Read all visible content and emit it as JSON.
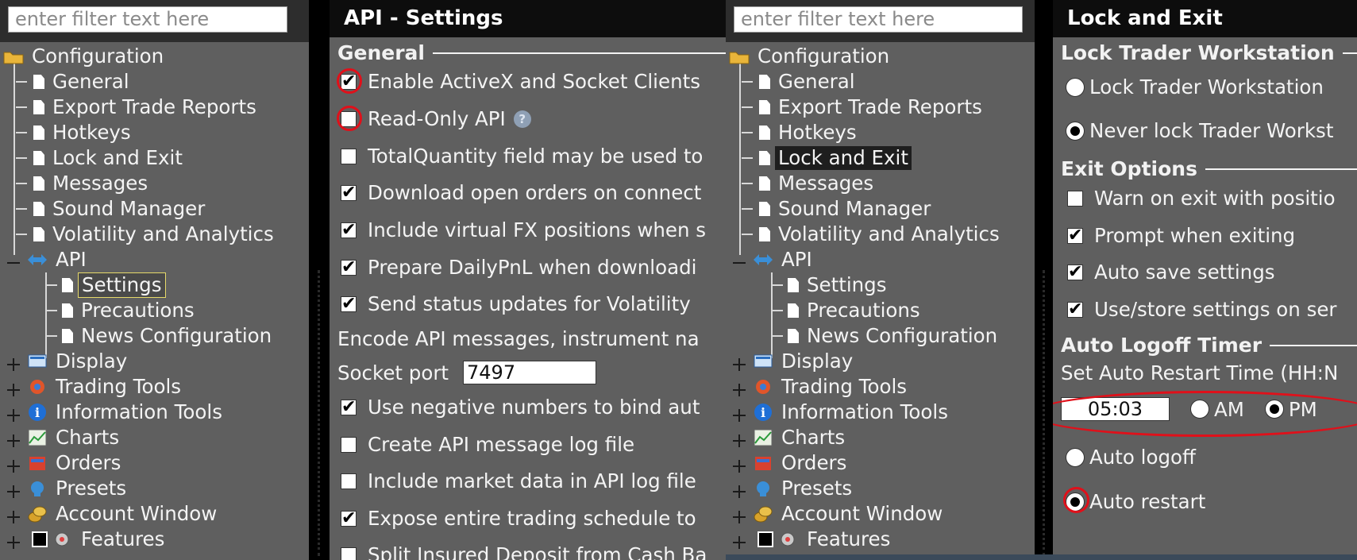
{
  "filter_placeholder": "enter filter text here",
  "tree": {
    "root": "Configuration",
    "items": {
      "general": "General",
      "export": "Export Trade Reports",
      "hotkeys": "Hotkeys",
      "lock": "Lock and Exit",
      "messages": "Messages",
      "sound": "Sound Manager",
      "volatility": "Volatility and Analytics",
      "api": "API",
      "settings": "Settings",
      "precautions": "Precautions",
      "news": "News Configuration",
      "display": "Display",
      "trading_tools": "Trading Tools",
      "info_tools": "Information Tools",
      "charts": "Charts",
      "orders": "Orders",
      "presets": "Presets",
      "account": "Account Window",
      "features": "Features"
    }
  },
  "api_panel": {
    "title": "API - Settings",
    "section_general": "General",
    "enable_activex": "Enable ActiveX and Socket Clients",
    "read_only": "Read-Only API",
    "help_glyph": "?",
    "total_quantity": "TotalQuantity field may be used to",
    "download_orders": "Download open orders on connect",
    "include_fx": "Include virtual FX positions when s",
    "prepare_pnl": "Prepare DailyPnL when downloadi",
    "send_status": "Send status updates for Volatility",
    "encode_api": "Encode API messages, instrument na",
    "socket_label": "Socket port",
    "socket_value": "7497",
    "negative_numbers": "Use negative numbers to bind aut",
    "create_log": "Create API message log file",
    "include_market": "Include market data in API log file",
    "expose_schedule": "Expose entire trading schedule to",
    "split_insured": "Split Insured Deposit from Cash Ba"
  },
  "lock_panel": {
    "title": "Lock and Exit",
    "section_lock": "Lock Trader Workstation",
    "lock_option": "Lock Trader Workstation",
    "never_lock": "Never lock Trader Workst",
    "section_exit": "Exit Options",
    "warn_exit": "Warn on exit with positio",
    "prompt_exit": "Prompt when exiting",
    "auto_save": "Auto save settings",
    "use_store": "Use/store settings on ser",
    "section_logoff": "Auto Logoff Timer",
    "restart_label": "Set Auto Restart Time (HH:N",
    "time_value": "05:03",
    "am": "AM",
    "pm": "PM",
    "auto_logoff": "Auto logoff",
    "auto_restart": "Auto restart"
  },
  "checked_glyph": "✔",
  "colors": {
    "panel_bg": "#5f5f5f",
    "title_bar": "#0d0d0d",
    "highlight_ring": "#e0101a",
    "focus_border": "#e6d96a"
  }
}
